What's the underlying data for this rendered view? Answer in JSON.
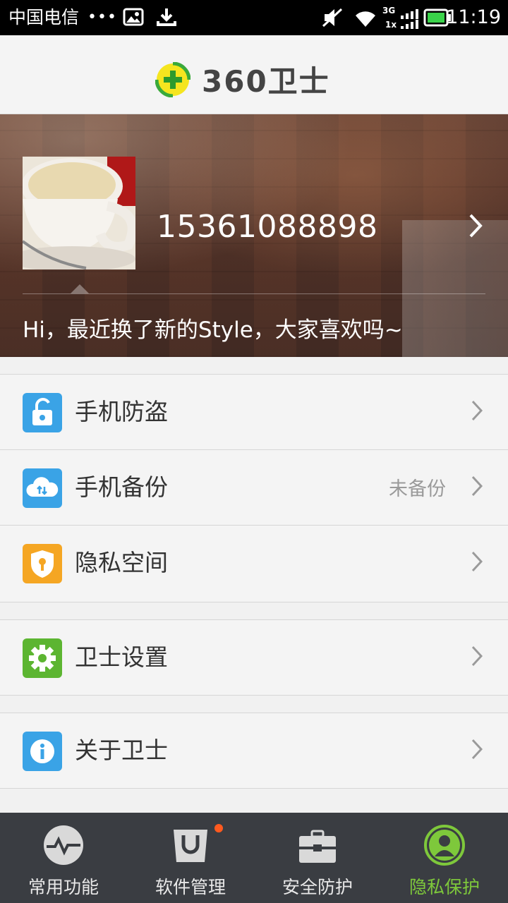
{
  "status_bar": {
    "carrier": "中国电信",
    "dots": "•••",
    "network": "3G",
    "network2": "1x",
    "time": "11:19"
  },
  "header": {
    "logo_text": "360卫士"
  },
  "profile": {
    "phone": "15361088898",
    "greeting": "Hi，最近换了新的Style，大家喜欢吗~"
  },
  "menu": {
    "group1": [
      {
        "label": "手机防盗",
        "value": "",
        "icon": "lock-icon",
        "color": "#3aa3e6"
      },
      {
        "label": "手机备份",
        "value": "未备份",
        "icon": "cloud-sync-icon",
        "color": "#3aa3e6"
      },
      {
        "label": "隐私空间",
        "value": "",
        "icon": "shield-key-icon",
        "color": "#f5a623"
      }
    ],
    "group2": [
      {
        "label": "卫士设置",
        "value": "",
        "icon": "gear-icon",
        "color": "#5cb531"
      }
    ],
    "group3": [
      {
        "label": "关于卫士",
        "value": "",
        "icon": "info-icon",
        "color": "#3aa3e6"
      }
    ]
  },
  "tabs": [
    {
      "label": "常用功能",
      "icon": "pulse-icon"
    },
    {
      "label": "软件管理",
      "icon": "shopping-bag-icon"
    },
    {
      "label": "安全防护",
      "icon": "toolbox-icon"
    },
    {
      "label": "隐私保护",
      "icon": "person-icon",
      "active": true
    }
  ],
  "colors": {
    "accent_green": "#7ec83b",
    "tabbar_bg": "#3a3d42",
    "badge": "#ff5a1f"
  }
}
